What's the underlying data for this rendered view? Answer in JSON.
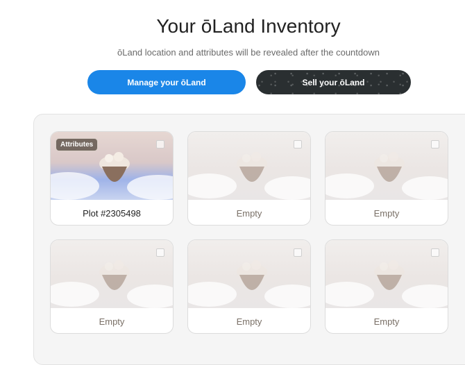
{
  "header": {
    "title": "Your ōLand Inventory",
    "subtitle": "ōLand location and attributes will be revealed after the countdown"
  },
  "actions": {
    "manage_label": "Manage your ōLand",
    "sell_label": "Sell your ōLand"
  },
  "inventory": {
    "cards": [
      {
        "label": "Plot #2305498",
        "badge": "Attributes",
        "state": "owned"
      },
      {
        "label": "Empty",
        "state": "empty"
      },
      {
        "label": "Empty",
        "state": "empty"
      },
      {
        "label": "Empty",
        "state": "empty"
      },
      {
        "label": "Empty",
        "state": "empty"
      },
      {
        "label": "Empty",
        "state": "empty"
      }
    ]
  },
  "colors": {
    "primary_button": "#1a86e8",
    "secondary_button": "#2a2f31"
  }
}
